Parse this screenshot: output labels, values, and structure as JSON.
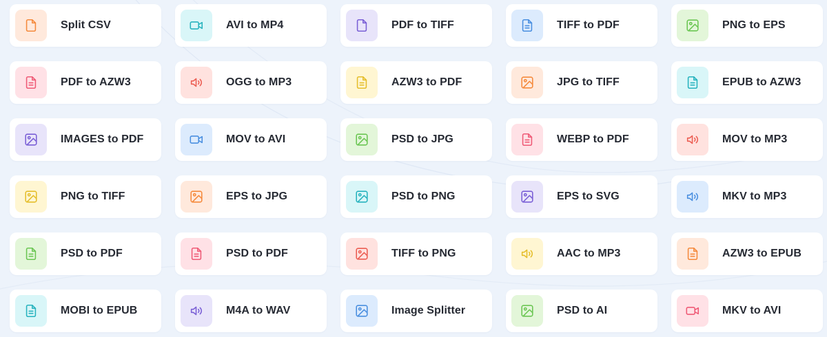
{
  "palette": {
    "orange": {
      "bg": "#ffe9dc",
      "fg": "#f58a3c"
    },
    "cyan": {
      "bg": "#d9f6f8",
      "fg": "#27b3be"
    },
    "purple": {
      "bg": "#e8e4fa",
      "fg": "#7a5fd6"
    },
    "blue": {
      "bg": "#dcebfd",
      "fg": "#4a8fe0"
    },
    "green": {
      "bg": "#e3f6d9",
      "fg": "#6bc653"
    },
    "pink": {
      "bg": "#ffe1e6",
      "fg": "#ef5a76"
    },
    "red": {
      "bg": "#ffe2df",
      "fg": "#ec5d52"
    },
    "yellow": {
      "bg": "#fff6d2",
      "fg": "#e5be2b"
    }
  },
  "tools": [
    {
      "name": "split-csv",
      "label": "Split CSV",
      "icon": "file-icon",
      "color": "orange"
    },
    {
      "name": "avi-to-mp4",
      "label": "AVI to MP4",
      "icon": "video-icon",
      "color": "cyan"
    },
    {
      "name": "pdf-to-tiff",
      "label": "PDF to TIFF",
      "icon": "file-icon",
      "color": "purple"
    },
    {
      "name": "tiff-to-pdf",
      "label": "TIFF to PDF",
      "icon": "document-icon",
      "color": "blue"
    },
    {
      "name": "png-to-eps",
      "label": "PNG to EPS",
      "icon": "image-icon",
      "color": "green"
    },
    {
      "name": "pdf-to-azw3",
      "label": "PDF to AZW3",
      "icon": "document-icon",
      "color": "pink"
    },
    {
      "name": "ogg-to-mp3",
      "label": "OGG to MP3",
      "icon": "audio-icon",
      "color": "red"
    },
    {
      "name": "azw3-to-pdf",
      "label": "AZW3 to PDF",
      "icon": "document-icon",
      "color": "yellow"
    },
    {
      "name": "jpg-to-tiff",
      "label": "JPG to TIFF",
      "icon": "image-icon",
      "color": "orange"
    },
    {
      "name": "epub-to-azw3",
      "label": "EPUB to AZW3",
      "icon": "document-icon",
      "color": "cyan"
    },
    {
      "name": "images-to-pdf",
      "label": "IMAGES to PDF",
      "icon": "image-icon",
      "color": "purple"
    },
    {
      "name": "mov-to-avi",
      "label": "MOV to AVI",
      "icon": "video-icon",
      "color": "blue"
    },
    {
      "name": "psd-to-jpg",
      "label": "PSD to JPG",
      "icon": "image-icon",
      "color": "green"
    },
    {
      "name": "webp-to-pdf",
      "label": "WEBP to PDF",
      "icon": "document-icon",
      "color": "pink"
    },
    {
      "name": "mov-to-mp3",
      "label": "MOV to MP3",
      "icon": "audio-icon",
      "color": "red"
    },
    {
      "name": "png-to-tiff",
      "label": "PNG to TIFF",
      "icon": "image-icon",
      "color": "yellow"
    },
    {
      "name": "eps-to-jpg",
      "label": "EPS to JPG",
      "icon": "image-icon",
      "color": "orange"
    },
    {
      "name": "psd-to-png",
      "label": "PSD to PNG",
      "icon": "image-icon",
      "color": "cyan"
    },
    {
      "name": "eps-to-svg",
      "label": "EPS to SVG",
      "icon": "image-icon",
      "color": "purple"
    },
    {
      "name": "mkv-to-mp3",
      "label": "MKV to MP3",
      "icon": "audio-icon",
      "color": "blue"
    },
    {
      "name": "psd-to-pdf-green",
      "label": "PSD to PDF",
      "icon": "document-icon",
      "color": "green"
    },
    {
      "name": "psd-to-pdf-pink",
      "label": "PSD to PDF",
      "icon": "document-icon",
      "color": "pink"
    },
    {
      "name": "tiff-to-png",
      "label": "TIFF to PNG",
      "icon": "image-icon",
      "color": "red"
    },
    {
      "name": "aac-to-mp3",
      "label": "AAC to MP3",
      "icon": "audio-icon",
      "color": "yellow"
    },
    {
      "name": "azw3-to-epub",
      "label": "AZW3 to EPUB",
      "icon": "document-icon",
      "color": "orange"
    },
    {
      "name": "mobi-to-epub",
      "label": "MOBI to EPUB",
      "icon": "document-icon",
      "color": "cyan"
    },
    {
      "name": "m4a-to-wav",
      "label": "M4A to WAV",
      "icon": "audio-icon",
      "color": "purple"
    },
    {
      "name": "image-splitter",
      "label": "Image Splitter",
      "icon": "image-icon",
      "color": "blue"
    },
    {
      "name": "psd-to-ai",
      "label": "PSD to AI",
      "icon": "image-icon",
      "color": "green"
    },
    {
      "name": "mkv-to-avi",
      "label": "MKV to AVI",
      "icon": "video-icon",
      "color": "pink"
    }
  ]
}
